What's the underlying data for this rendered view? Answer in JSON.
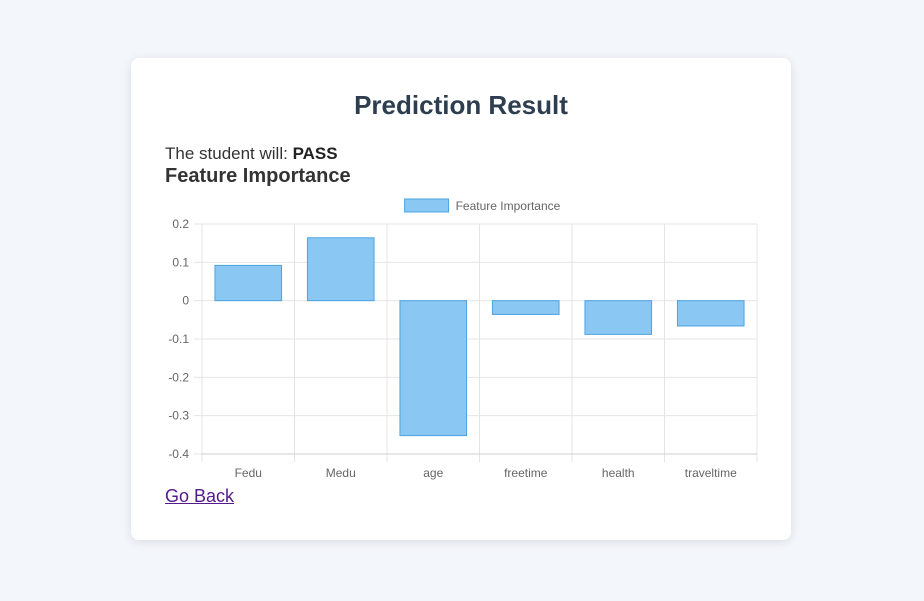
{
  "page": {
    "title": "Prediction Result",
    "result_prefix": "The student will: ",
    "result_value": "PASS",
    "section_title": "Feature Importance",
    "back_link": "Go Back"
  },
  "chart_data": {
    "type": "bar",
    "categories": [
      "Fedu",
      "Medu",
      "age",
      "freetime",
      "health",
      "traveltime"
    ],
    "series": [
      {
        "name": "Feature Importance",
        "values": [
          0.092,
          0.164,
          -0.352,
          -0.036,
          -0.088,
          -0.066
        ],
        "fill": "#8ac7f2",
        "stroke": "#4ba3e3"
      }
    ],
    "ylim": [
      -0.4,
      0.2
    ],
    "yticks": [
      0.2,
      0.1,
      0,
      -0.1,
      -0.2,
      -0.3,
      -0.4
    ],
    "ytick_labels": [
      "0.2",
      "0.1",
      "0",
      "-0.1",
      "-0.2",
      "-0.3",
      "-0.4"
    ],
    "grid": true,
    "legend": "top-center"
  }
}
